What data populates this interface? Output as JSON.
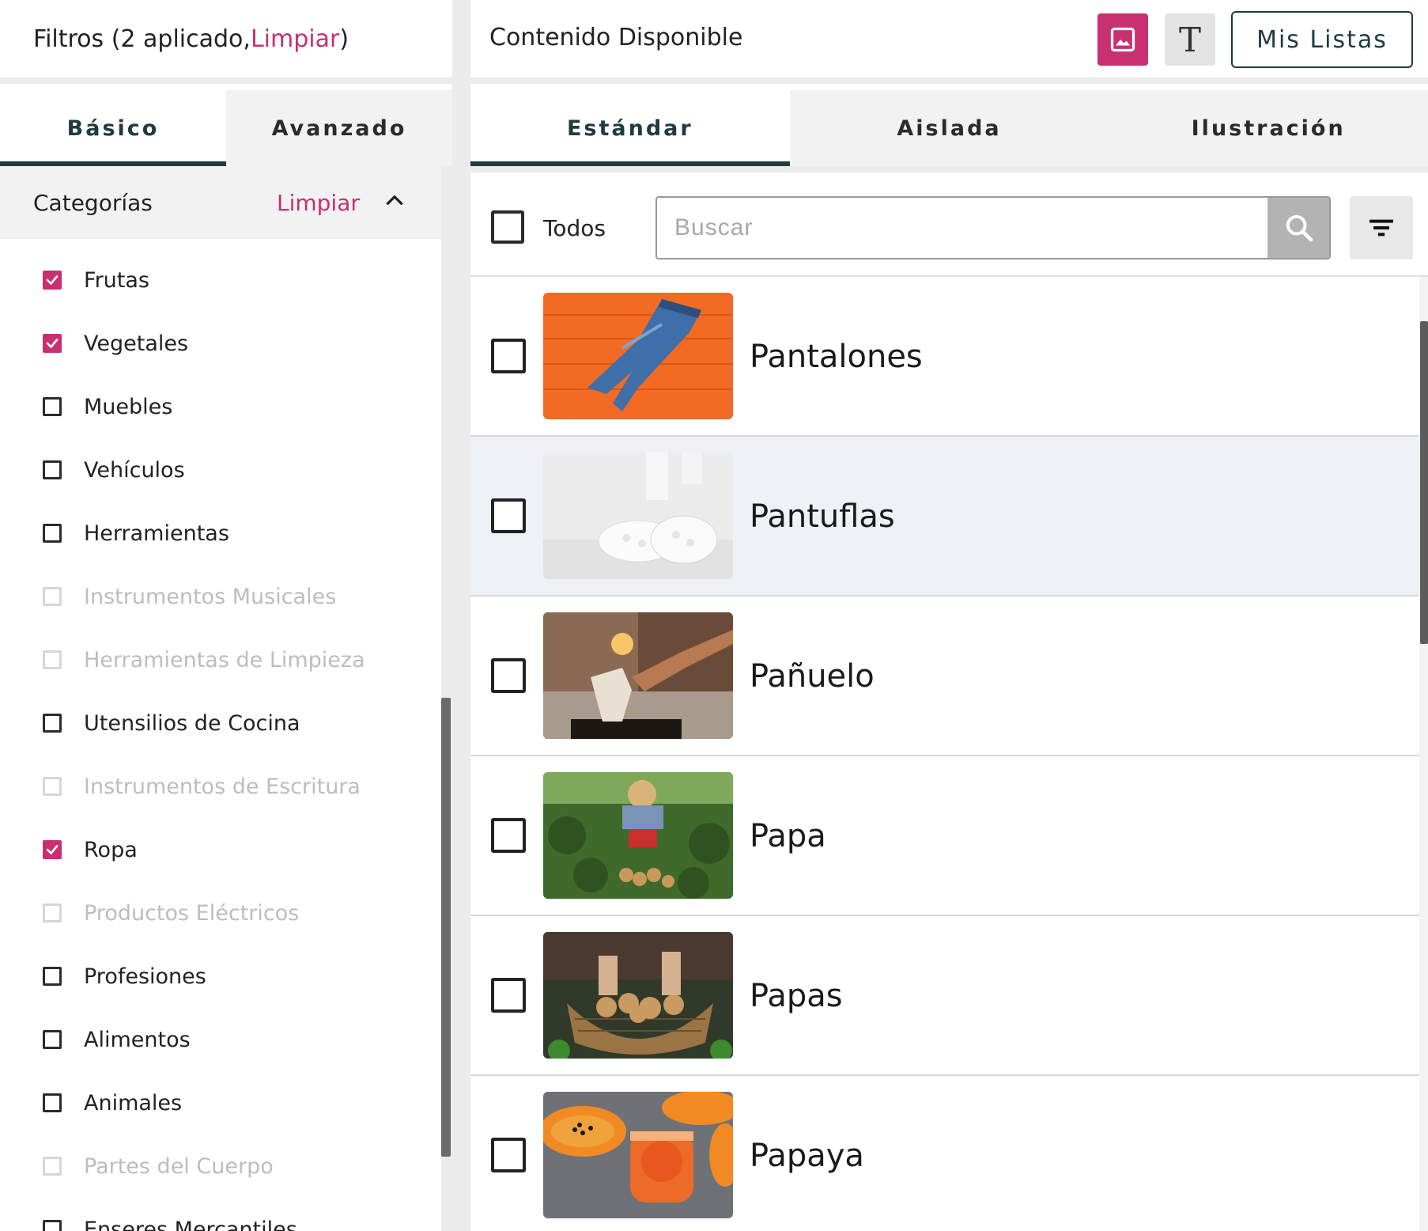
{
  "filters": {
    "prefix": "Filtros (2 aplicado, ",
    "clear_link": "Limpiar",
    "suffix": ")"
  },
  "left_tabs": [
    {
      "label": "Básico",
      "active": true
    },
    {
      "label": "Avanzado",
      "active": false
    }
  ],
  "categories_header": {
    "title": "Categorías",
    "clear_label": "Limpiar"
  },
  "categories": [
    {
      "label": "Frutas",
      "checked": true,
      "disabled": false
    },
    {
      "label": "Vegetales",
      "checked": true,
      "disabled": false
    },
    {
      "label": "Muebles",
      "checked": false,
      "disabled": false
    },
    {
      "label": "Vehículos",
      "checked": false,
      "disabled": false
    },
    {
      "label": "Herramientas",
      "checked": false,
      "disabled": false
    },
    {
      "label": "Instrumentos Musicales",
      "checked": false,
      "disabled": true
    },
    {
      "label": "Herramientas de Limpieza",
      "checked": false,
      "disabled": true
    },
    {
      "label": "Utensilios de Cocina",
      "checked": false,
      "disabled": false
    },
    {
      "label": "Instrumentos de Escritura",
      "checked": false,
      "disabled": true
    },
    {
      "label": "Ropa",
      "checked": true,
      "disabled": false
    },
    {
      "label": "Productos Eléctricos",
      "checked": false,
      "disabled": true
    },
    {
      "label": "Profesiones",
      "checked": false,
      "disabled": false
    },
    {
      "label": "Alimentos",
      "checked": false,
      "disabled": false
    },
    {
      "label": "Animales",
      "checked": false,
      "disabled": false
    },
    {
      "label": "Partes del Cuerpo",
      "checked": false,
      "disabled": true
    },
    {
      "label": "Enseres Mercantiles",
      "checked": false,
      "disabled": false
    }
  ],
  "content": {
    "title": "Contenido Disponible",
    "image_mode_icon": "image-icon",
    "text_mode_glyph": "T",
    "my_lists_label": "Mis Listas"
  },
  "right_tabs": [
    {
      "label": "Estándar",
      "active": true
    },
    {
      "label": "Aislada",
      "active": false
    },
    {
      "label": "Ilustración",
      "active": false
    }
  ],
  "toolbar": {
    "select_all_label": "Todos",
    "search_placeholder": "Buscar",
    "search_value": ""
  },
  "results": [
    {
      "label": "Pantalones",
      "thumb": "pantalones"
    },
    {
      "label": "Pantuflas",
      "thumb": "pantuflas"
    },
    {
      "label": "Pañuelo",
      "thumb": "panuelo"
    },
    {
      "label": "Papa",
      "thumb": "papa"
    },
    {
      "label": "Papas",
      "thumb": "papas"
    },
    {
      "label": "Papaya",
      "thumb": "papaya"
    }
  ],
  "colors": {
    "accent": "#c8306f",
    "tab_underline": "#1f3b40"
  }
}
